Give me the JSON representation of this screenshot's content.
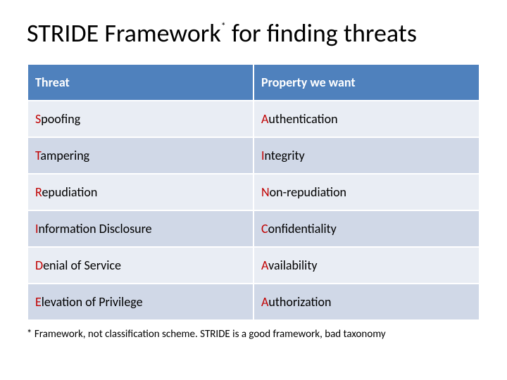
{
  "title_a": "STRIDE Framework",
  "title_b": " for finding threats",
  "sup": "*",
  "table": {
    "headers": {
      "c0": "Threat",
      "c1": "Property we want"
    },
    "rows": [
      {
        "c0": "Spoofing",
        "c1": "Authentication"
      },
      {
        "c0": "Tampering",
        "c1": "Integrity"
      },
      {
        "c0": "Repudiation",
        "c1": "Non-repudiation"
      },
      {
        "c0": "Information Disclosure",
        "c1": "Confidentiality"
      },
      {
        "c0": "Denial of Service",
        "c1": "Availability"
      },
      {
        "c0": "Elevation of Privilege",
        "c1": "Authorization"
      }
    ]
  },
  "footnote": "* Framework, not classification scheme.  STRIDE is a good framework, bad taxonomy"
}
